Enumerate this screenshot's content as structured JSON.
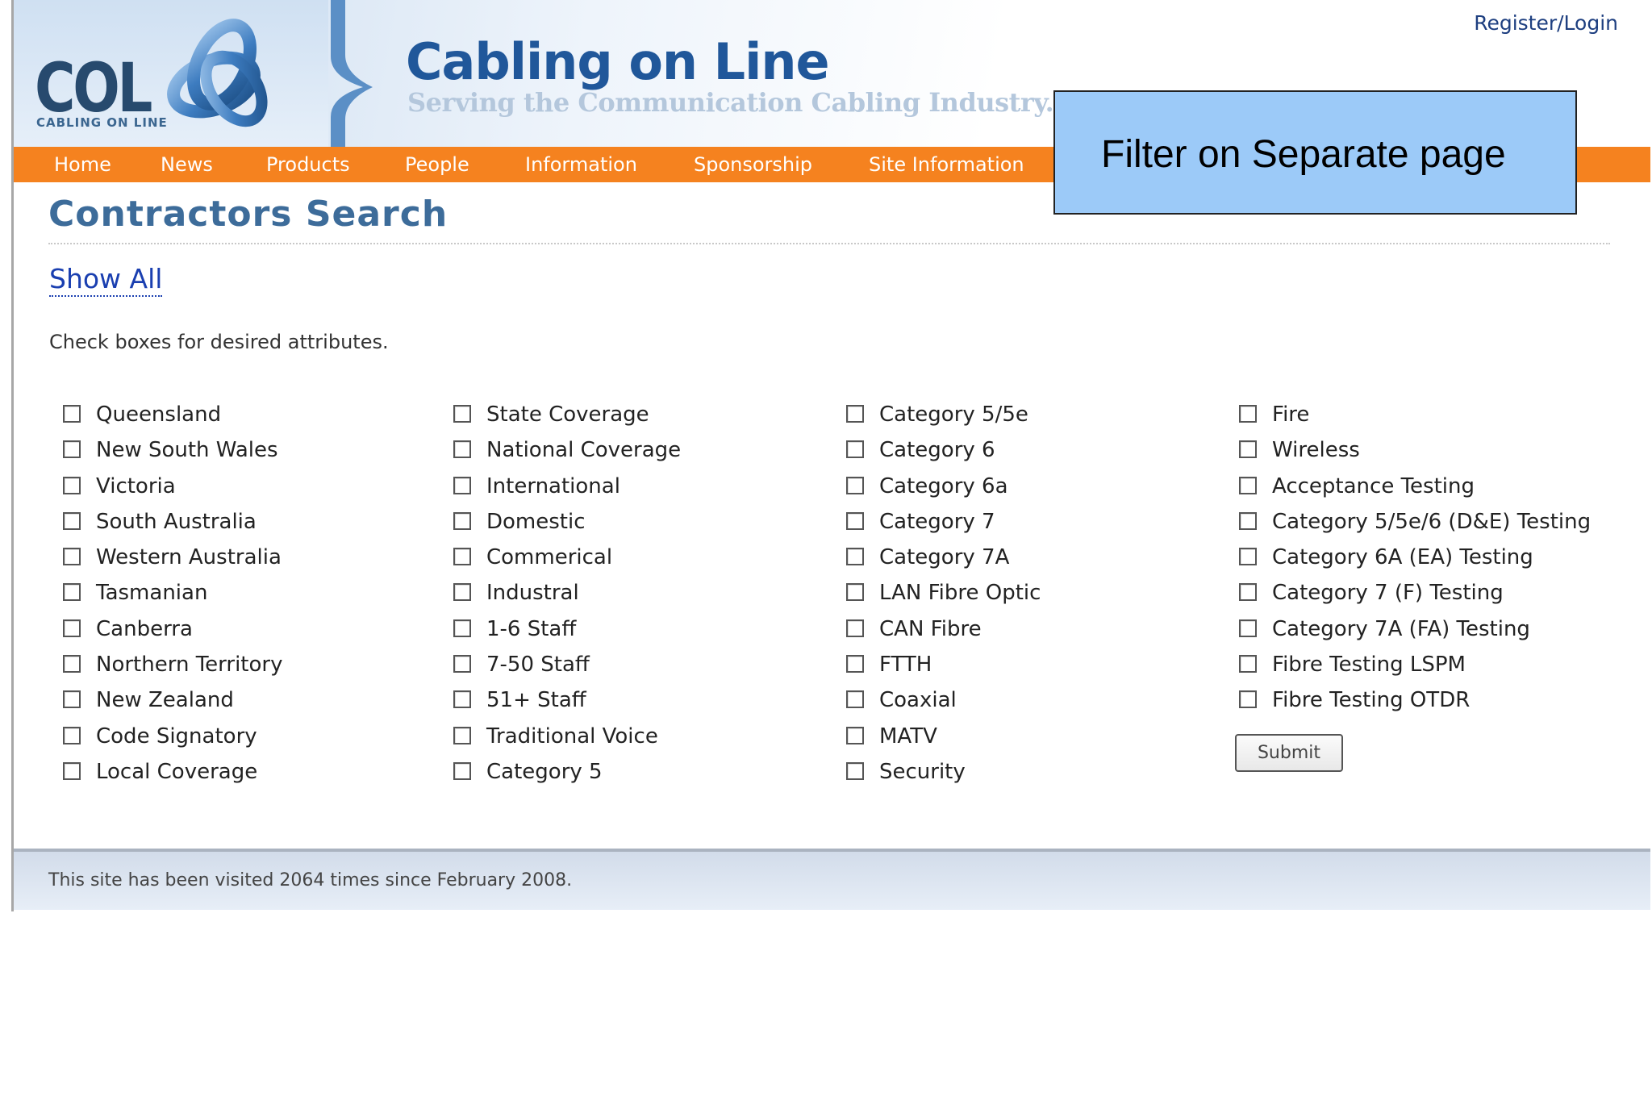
{
  "header": {
    "logo_text": "COL",
    "logo_subtext": "CABLING ON LINE",
    "site_title": "Cabling on Line",
    "tagline": "Serving the Communication Cabling Industry.",
    "register_login": "Register/Login"
  },
  "nav": {
    "items": [
      "Home",
      "News",
      "Products",
      "People",
      "Information",
      "Sponsorship",
      "Site Information"
    ]
  },
  "callout": {
    "text": "Filter on Separate page",
    "color": "#9ccaf8"
  },
  "main": {
    "title": "Contractors Search",
    "show_all": "Show All",
    "instructions": "Check boxes for desired attributes.",
    "columns": [
      [
        "Queensland",
        "New South Wales",
        "Victoria",
        "South Australia",
        "Western Australia",
        "Tasmanian",
        "Canberra",
        "Northern Territory",
        "New Zealand",
        "Code Signatory",
        "Local Coverage"
      ],
      [
        "State Coverage",
        "National Coverage",
        "International",
        "Domestic",
        "Commerical",
        "Industral",
        "1-6 Staff",
        "7-50 Staff",
        "51+ Staff",
        "Traditional Voice",
        "Category 5"
      ],
      [
        "Category 5/5e",
        "Category 6",
        "Category 6a",
        "Category 7",
        "Category 7A",
        "LAN Fibre Optic",
        "CAN Fibre",
        "FTTH",
        "Coaxial",
        "MATV",
        "Security"
      ],
      [
        "Fire",
        "Wireless",
        "Acceptance Testing",
        "Category 5/5e/6 (D&E) Testing",
        "Category 6A (EA) Testing",
        "Category 7 (F) Testing",
        "Category 7A (FA) Testing",
        "Fibre Testing LSPM",
        "Fibre Testing OTDR"
      ]
    ],
    "submit_label": "Submit"
  },
  "footer": {
    "text": "This site has been visited 2064 times since February 2008."
  },
  "colors": {
    "nav": "#f5821f",
    "title": "#3d6c9a",
    "link": "#1a3fb0"
  }
}
